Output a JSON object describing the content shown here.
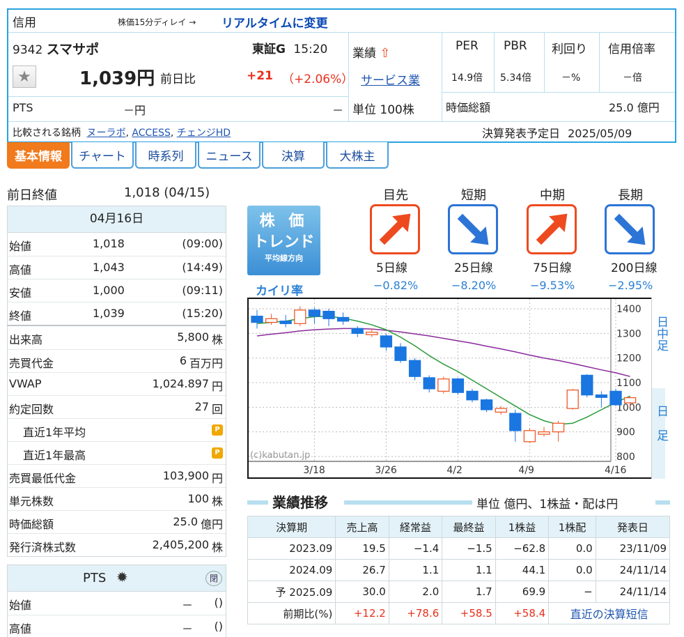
{
  "header": {
    "badge": "信用",
    "delay_note": "株価15分ディレイ →",
    "realtime_link": "リアルタイムに変更",
    "code": "9342",
    "name": "スマサポ",
    "market": "東証G",
    "time": "15:20",
    "price": "1,039円",
    "change_label": "前日比",
    "change": "+21",
    "change_pct": "（+2.06%）",
    "pts_label": "PTS",
    "pts_value": "－円",
    "pts_change": "－",
    "gyoseki": "業績",
    "industry": "サービス業",
    "unit": "単位 100株",
    "metrics_headers": [
      "PER",
      "PBR",
      "利回り",
      "信用倍率"
    ],
    "metrics_values": [
      "14.9倍",
      "5.34倍",
      "－%",
      "－倍"
    ],
    "market_cap_label": "時価総額",
    "market_cap": "25.0 億円",
    "compare_label": "比較される銘柄",
    "compare": [
      "ヌーラボ",
      "ACCESS",
      "チェンジHD"
    ],
    "earnings_label": "決算発表予定日",
    "earnings_date": "2025/05/09"
  },
  "tabs": [
    "基本情報",
    "チャート",
    "時系列",
    "ニュース",
    "決算",
    "大株主"
  ],
  "prev_close": {
    "label": "前日終値",
    "value": "1,018 (04/15)"
  },
  "day": {
    "date": "04月16日",
    "rows": [
      {
        "label": "始値",
        "value": "1,018",
        "time": "(09:00)"
      },
      {
        "label": "高値",
        "value": "1,043",
        "time": "(14:49)"
      },
      {
        "label": "安値",
        "value": "1,000",
        "time": "(09:11)"
      },
      {
        "label": "終値",
        "value": "1,039",
        "time": "(15:20)"
      }
    ]
  },
  "stats": [
    {
      "label": "出来高",
      "value": "5,800",
      "unit": "株"
    },
    {
      "label": "売買代金",
      "value": "6",
      "unit": "百万円"
    },
    {
      "label": "VWAP",
      "value": "1,024.897",
      "unit": "円"
    },
    {
      "label": "約定回数",
      "value": "27",
      "unit": "回"
    },
    {
      "label": "直近1年平均",
      "value": "",
      "unit": ""
    },
    {
      "label": "直近1年最高",
      "value": "",
      "unit": ""
    },
    {
      "label": "売買最低代金",
      "value": "103,900",
      "unit": "円"
    },
    {
      "label": "単元株数",
      "value": "100",
      "unit": "株"
    },
    {
      "label": "時価総額",
      "value": "25.0",
      "unit": "億円"
    },
    {
      "label": "発行済株式数",
      "value": "2,405,200",
      "unit": "株"
    }
  ],
  "pts_panel": {
    "title": "PTS",
    "close_btn": "閉",
    "rows": [
      {
        "label": "始値",
        "value": "－",
        "time": "()"
      },
      {
        "label": "高値",
        "value": "－",
        "time": "()"
      }
    ]
  },
  "trend": {
    "label_line1": "株 価",
    "label_line2": "トレンド",
    "label_line3": "平均線方向",
    "kairi_label": "カイリ率",
    "items": [
      {
        "period": "目先",
        "line": "5日線",
        "dir": "up",
        "kairi": "−0.82%"
      },
      {
        "period": "短期",
        "line": "25日線",
        "dir": "down",
        "kairi": "−8.20%"
      },
      {
        "period": "中期",
        "line": "75日線",
        "dir": "up",
        "kairi": "−9.53%"
      },
      {
        "period": "長期",
        "line": "200日線",
        "dir": "down",
        "kairi": "−2.95%"
      }
    ]
  },
  "chart_data": {
    "type": "candlestick",
    "watermark": "(c)kabutan.jp",
    "x_ticks": [
      "3/18",
      "3/26",
      "4/2",
      "4/9",
      "4/16"
    ],
    "y_ticks": [
      1400,
      1300,
      1200,
      1100,
      1000,
      900,
      800
    ],
    "ylim": [
      780,
      1440
    ],
    "side_tabs": [
      "日中足",
      "日足"
    ],
    "candles": [
      {
        "o": 1370,
        "c": 1345,
        "h": 1395,
        "l": 1320
      },
      {
        "o": 1345,
        "c": 1360,
        "h": 1380,
        "l": 1335
      },
      {
        "o": 1350,
        "c": 1340,
        "h": 1375,
        "l": 1325
      },
      {
        "o": 1340,
        "c": 1395,
        "h": 1410,
        "l": 1330
      },
      {
        "o": 1395,
        "c": 1370,
        "h": 1405,
        "l": 1340
      },
      {
        "o": 1390,
        "c": 1360,
        "h": 1400,
        "l": 1330
      },
      {
        "o": 1365,
        "c": 1350,
        "h": 1385,
        "l": 1335
      },
      {
        "o": 1320,
        "c": 1300,
        "h": 1330,
        "l": 1285
      },
      {
        "o": 1295,
        "c": 1305,
        "h": 1320,
        "l": 1285
      },
      {
        "o": 1290,
        "c": 1245,
        "h": 1300,
        "l": 1230
      },
      {
        "o": 1245,
        "c": 1190,
        "h": 1260,
        "l": 1180
      },
      {
        "o": 1190,
        "c": 1125,
        "h": 1200,
        "l": 1110
      },
      {
        "o": 1120,
        "c": 1075,
        "h": 1130,
        "l": 1060
      },
      {
        "o": 1065,
        "c": 1115,
        "h": 1125,
        "l": 1055
      },
      {
        "o": 1115,
        "c": 1060,
        "h": 1120,
        "l": 1050
      },
      {
        "o": 1065,
        "c": 1030,
        "h": 1075,
        "l": 1020
      },
      {
        "o": 1030,
        "c": 990,
        "h": 1035,
        "l": 980
      },
      {
        "o": 980,
        "c": 995,
        "h": 1005,
        "l": 970
      },
      {
        "o": 975,
        "c": 905,
        "h": 990,
        "l": 860
      },
      {
        "o": 860,
        "c": 905,
        "h": 915,
        "l": 855
      },
      {
        "o": 890,
        "c": 900,
        "h": 920,
        "l": 880
      },
      {
        "o": 900,
        "c": 935,
        "h": 945,
        "l": 860
      },
      {
        "o": 995,
        "c": 1070,
        "h": 1075,
        "l": 990
      },
      {
        "o": 1130,
        "c": 1050,
        "h": 1135,
        "l": 1040
      },
      {
        "o": 1050,
        "c": 1040,
        "h": 1065,
        "l": 1000
      },
      {
        "o": 1065,
        "c": 1010,
        "h": 1075,
        "l": 1005
      },
      {
        "o": 1018,
        "c": 1039,
        "h": 1043,
        "l": 1000
      }
    ],
    "ma_short": [
      1340,
      1345,
      1350,
      1360,
      1368,
      1370,
      1362,
      1350,
      1335,
      1315,
      1285,
      1250,
      1210,
      1175,
      1145,
      1110,
      1075,
      1040,
      1005,
      970,
      945,
      930,
      935,
      960,
      990,
      1020,
      1045
    ],
    "ma_long": [
      1290,
      1297,
      1303,
      1310,
      1315,
      1318,
      1320,
      1320,
      1318,
      1313,
      1306,
      1298,
      1290,
      1280,
      1270,
      1260,
      1248,
      1237,
      1225,
      1212,
      1200,
      1190,
      1178,
      1165,
      1152,
      1140,
      1125
    ]
  },
  "performance": {
    "title": "業績推移",
    "unit_note": "単位 億円、1株益・配は円",
    "headers": [
      "決算期",
      "売上高",
      "経常益",
      "最終益",
      "1株益",
      "1株配",
      "発表日"
    ],
    "rows": [
      [
        "2023.09",
        "19.5",
        "−1.4",
        "−1.5",
        "−62.8",
        "0.0",
        "23/11/09"
      ],
      [
        "2024.09",
        "26.7",
        "1.1",
        "1.1",
        "44.1",
        "0.0",
        "24/11/14"
      ],
      [
        "予 2025.09",
        "30.0",
        "2.0",
        "1.7",
        "69.9",
        "−",
        "24/11/14"
      ]
    ],
    "yoy_label": "前期比(%)",
    "yoy": [
      "+12.2",
      "+78.6",
      "+58.5",
      "+58.4"
    ],
    "tanshin_link": "直近の決算短信"
  },
  "colors": {
    "accent": "#29a3e0",
    "up": "#e8301c",
    "bull_candle": "#ee5a2a",
    "bear_candle": "#1a76e0",
    "tab_active": "#f07a1c"
  }
}
